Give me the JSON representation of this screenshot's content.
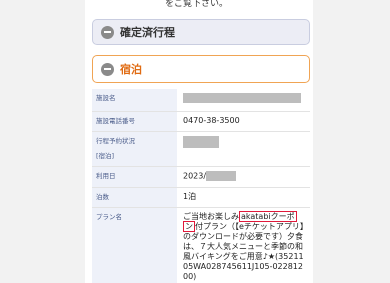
{
  "top_note": "をご覧下さい。",
  "sections": {
    "confirmed": {
      "title": "確定済行程"
    },
    "lodging": {
      "title": "宿泊"
    }
  },
  "rows": [
    {
      "label": "施設名",
      "value": ""
    },
    {
      "label": "施設電話番号",
      "value": "0470-38-3500"
    },
    {
      "label": "行程予約状況",
      "label2": "[宿泊]",
      "value": ""
    },
    {
      "label": "利用日",
      "value": "2023/"
    },
    {
      "label": "泊数",
      "value": "1泊"
    },
    {
      "label": "プラン名",
      "plan": {
        "part1": "ご当地お楽しみ",
        "highlight1": "akatabiクーポ",
        "highlight2": "ン",
        "part2": "付プラン（【eチケットアプリ】のダウンロードが必要です）",
        "part3": "夕食は、７大人気メニューと季節の和風バイキングをご用意♪★",
        "part4": "(3521105WA028745611J105-02281200)"
      }
    }
  ],
  "colors": {
    "accent_orange": "#e06b12",
    "highlight_red": "#e0193a",
    "label_bg": "#eef1f9"
  }
}
